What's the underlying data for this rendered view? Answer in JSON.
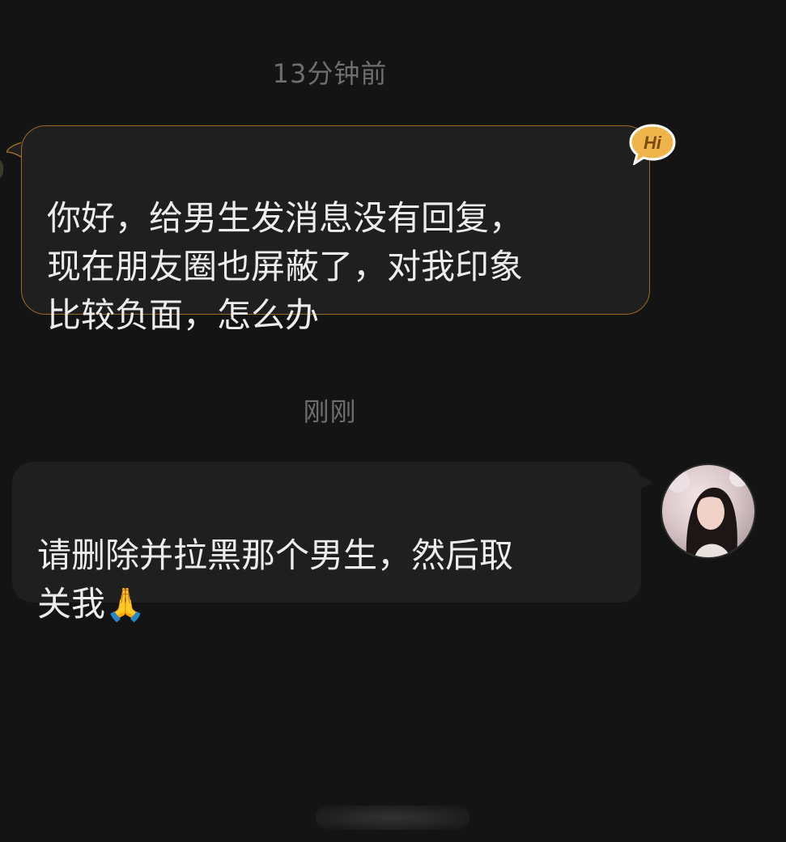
{
  "messages": [
    {
      "time": "13分钟前",
      "text": "你好，给男生发消息没有回复，\n现在朋友圈也屏蔽了，对我印象\n比较负面，怎么办",
      "badge": "Hi"
    },
    {
      "time": "刚刚",
      "text": "请删除并拉黑那个男生，然后取\n关我",
      "emoji": "🙏"
    }
  ],
  "colors": {
    "background": "#141414",
    "bubble": "#1f1f1f",
    "bubble_border": "#9a6a26",
    "badge": "#f0b54a",
    "timestamp": "#6e6e6e"
  },
  "icons": [
    "hi-badge-icon",
    "avatar"
  ]
}
